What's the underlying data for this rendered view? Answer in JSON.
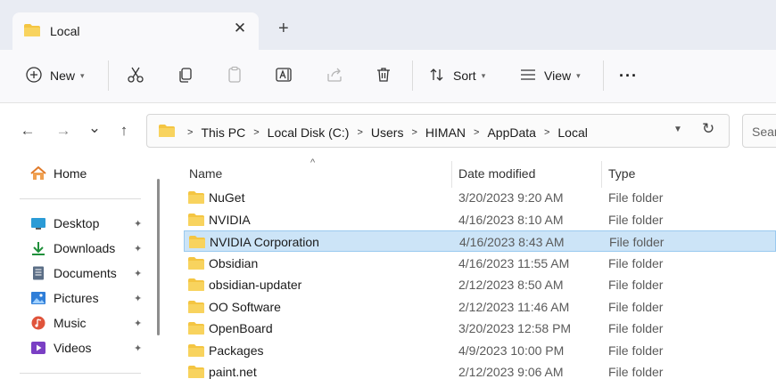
{
  "tab": {
    "title": "Local",
    "close_glyph": "✕",
    "new_tab_glyph": "+"
  },
  "toolbar": {
    "new_label": "New",
    "sort_label": "Sort",
    "view_label": "View",
    "more_glyph": "···",
    "icons": [
      "plus-circle-icon",
      "cut-icon",
      "copy-icon",
      "paste-icon",
      "rename-icon",
      "share-icon",
      "delete-icon",
      "sort-icon",
      "view-icon",
      "more-icon"
    ]
  },
  "nav": {
    "back_glyph": "←",
    "forward_glyph": "→",
    "recent_glyph": "⌄",
    "up_glyph": "↑"
  },
  "address": {
    "crumbs": [
      "This PC",
      "Local Disk (C:)",
      "Users",
      "HIMAN",
      "AppData",
      "Local"
    ],
    "separator": ">",
    "refresh_glyph": "↻"
  },
  "search": {
    "placeholder": "Sear"
  },
  "sidebar": {
    "home_label": "Home",
    "items": [
      {
        "label": "Desktop",
        "icon": "desktop-icon",
        "color": "#2b9bd6"
      },
      {
        "label": "Downloads",
        "icon": "download-icon",
        "color": "#1f8f3a"
      },
      {
        "label": "Documents",
        "icon": "document-icon",
        "color": "#5b6e86"
      },
      {
        "label": "Pictures",
        "icon": "pictures-icon",
        "color": "#2f7ed8"
      },
      {
        "label": "Music",
        "icon": "music-icon",
        "color": "#e0543b"
      },
      {
        "label": "Videos",
        "icon": "videos-icon",
        "color": "#7a3fc4"
      }
    ],
    "pin_glyph": "📌"
  },
  "columns": {
    "name": "Name",
    "date": "Date modified",
    "type": "Type"
  },
  "files": [
    {
      "name": "NuGet",
      "date": "3/20/2023 9:20 AM",
      "type": "File folder",
      "selected": false
    },
    {
      "name": "NVIDIA",
      "date": "4/16/2023 8:10 AM",
      "type": "File folder",
      "selected": false
    },
    {
      "name": "NVIDIA Corporation",
      "date": "4/16/2023 8:43 AM",
      "type": "File folder",
      "selected": true
    },
    {
      "name": "Obsidian",
      "date": "4/16/2023 11:55 AM",
      "type": "File folder",
      "selected": false
    },
    {
      "name": "obsidian-updater",
      "date": "2/12/2023 8:50 AM",
      "type": "File folder",
      "selected": false
    },
    {
      "name": "OO Software",
      "date": "2/12/2023 11:46 AM",
      "type": "File folder",
      "selected": false
    },
    {
      "name": "OpenBoard",
      "date": "3/20/2023 12:58 PM",
      "type": "File folder",
      "selected": false
    },
    {
      "name": "Packages",
      "date": "4/9/2023 10:00 PM",
      "type": "File folder",
      "selected": false
    },
    {
      "name": "paint.net",
      "date": "2/12/2023 9:06 AM",
      "type": "File folder",
      "selected": false
    }
  ],
  "colors": {
    "folder": "#f4c542",
    "selection": "#cce4f7",
    "accent": "#0067c0"
  }
}
